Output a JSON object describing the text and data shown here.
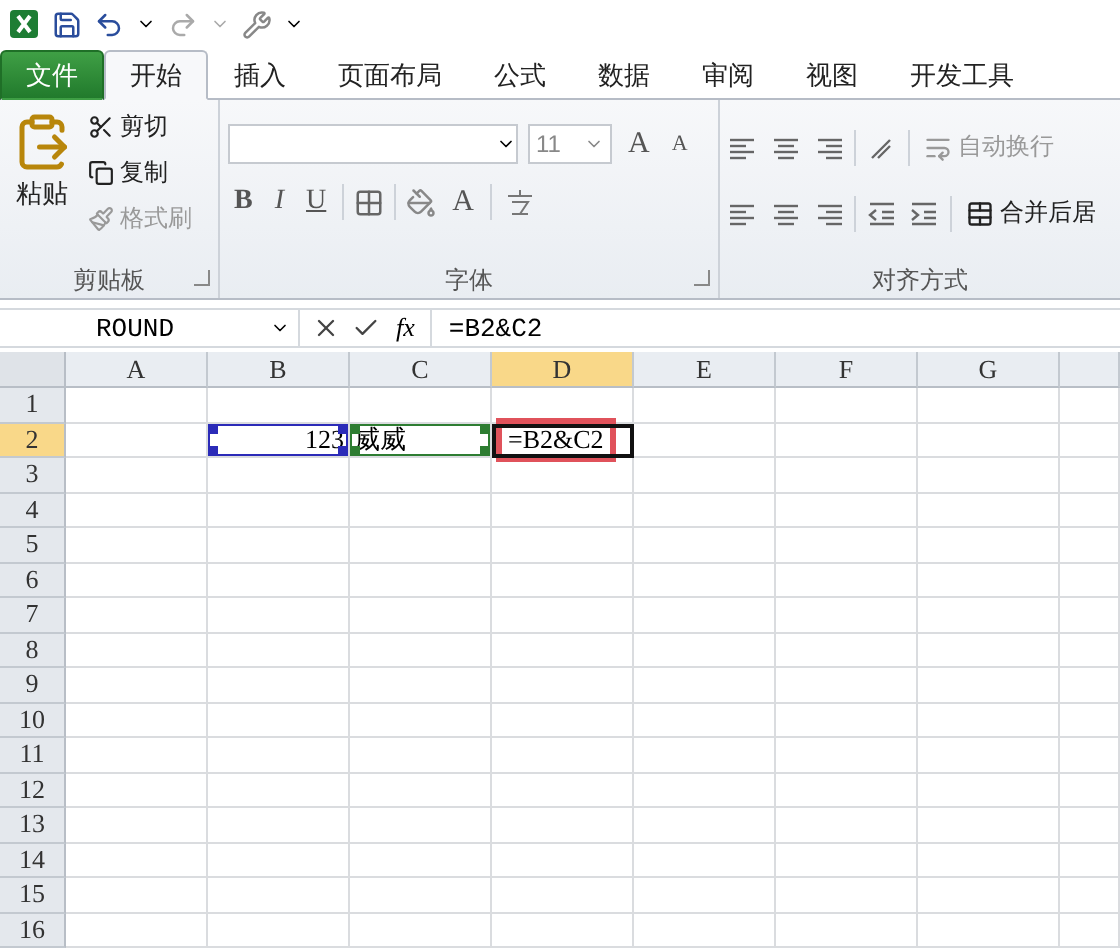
{
  "tabs": [
    {
      "label": "文件",
      "kind": "file",
      "selected": false
    },
    {
      "label": "开始",
      "kind": "tab",
      "selected": true
    },
    {
      "label": "插入",
      "kind": "tab",
      "selected": false
    },
    {
      "label": "页面布局",
      "kind": "tab",
      "selected": false
    },
    {
      "label": "公式",
      "kind": "tab",
      "selected": false
    },
    {
      "label": "数据",
      "kind": "tab",
      "selected": false
    },
    {
      "label": "审阅",
      "kind": "tab",
      "selected": false
    },
    {
      "label": "视图",
      "kind": "tab",
      "selected": false
    },
    {
      "label": "开发工具",
      "kind": "tab",
      "selected": false
    }
  ],
  "ribbon": {
    "clipboard": {
      "title": "剪贴板",
      "paste": "粘贴",
      "cut": "剪切",
      "copy": "复制",
      "format_painter": "格式刷"
    },
    "font": {
      "title": "字体",
      "size": "11",
      "grow": "A",
      "shrink": "A",
      "bold": "B",
      "italic": "I",
      "underline": "U",
      "font_color": "A"
    },
    "alignment": {
      "title": "对齐方式",
      "wrap_text": "自动换行",
      "merge": "合并后居"
    }
  },
  "formula_bar": {
    "name_box": "ROUND",
    "function_label": "fx",
    "formula": "=B2&C2"
  },
  "sheet": {
    "columns": [
      {
        "label": "A",
        "selected": false
      },
      {
        "label": "B",
        "selected": false
      },
      {
        "label": "C",
        "selected": false
      },
      {
        "label": "D",
        "selected": true
      },
      {
        "label": "E",
        "selected": false
      },
      {
        "label": "F",
        "selected": false
      },
      {
        "label": "G",
        "selected": false
      }
    ],
    "rows": [
      {
        "label": "1",
        "selected": false
      },
      {
        "label": "2",
        "selected": true,
        "cells": {
          "B": {
            "text": "123",
            "align_right": true,
            "color": "#2b2bb8"
          },
          "C": {
            "text": "威威",
            "align_right": false,
            "color": "#2e7d32"
          },
          "D": {
            "text": "=B2&C2",
            "align_right": false,
            "editing": true,
            "highlighted": true
          }
        }
      },
      {
        "label": "3",
        "selected": false
      },
      {
        "label": "4",
        "selected": false
      },
      {
        "label": "5",
        "selected": false
      },
      {
        "label": "6",
        "selected": false
      },
      {
        "label": "7",
        "selected": false
      },
      {
        "label": "8",
        "selected": false
      },
      {
        "label": "9",
        "selected": false
      },
      {
        "label": "10",
        "selected": false
      },
      {
        "label": "11",
        "selected": false
      },
      {
        "label": "12",
        "selected": false
      },
      {
        "label": "13",
        "selected": false
      },
      {
        "label": "14",
        "selected": false
      },
      {
        "label": "15",
        "selected": false
      },
      {
        "label": "16",
        "selected": false
      }
    ]
  }
}
